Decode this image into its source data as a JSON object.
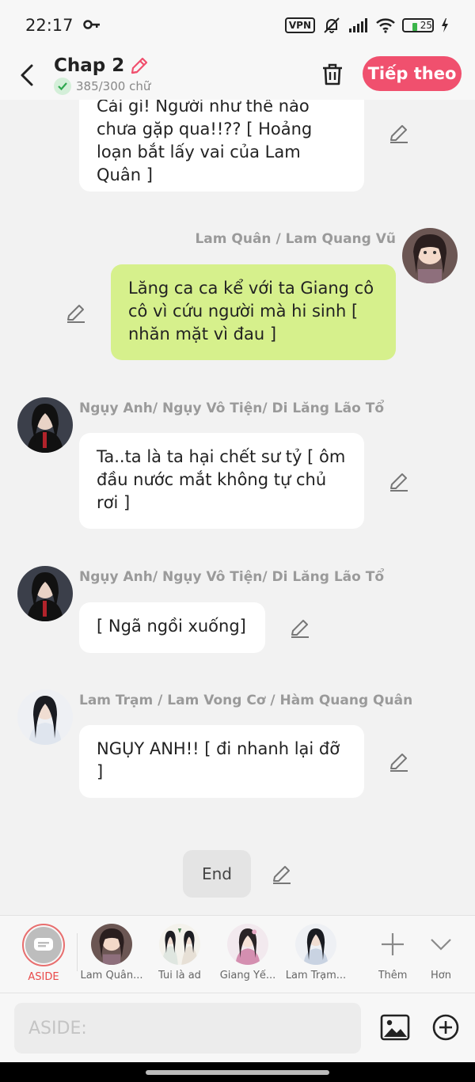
{
  "status_bar": {
    "time": "22:17",
    "vpn_label": "VPN",
    "battery": "25"
  },
  "header": {
    "title": "Chap 2",
    "word_count": "385/300 chữ",
    "next_label": "Tiếp theo"
  },
  "messages": [
    {
      "speaker": "",
      "text": "Cái gì! Người như thế nào chưa gặp qua!!?? [ Hoảng loạn bắt lấy vai của Lam Quân ]",
      "side": "left",
      "avatar_icon": "none"
    },
    {
      "speaker": "Lam Quân / Lam Quang Vũ",
      "text": "Lăng ca ca kể với ta Giang cô cô vì cứu người mà hi sinh [ nhăn mặt vì đau ]",
      "side": "right",
      "avatar_icon": "dark-hair-girl"
    },
    {
      "speaker": "Ngụy Anh/ Ngụy Vô Tiện/ Di Lăng Lão Tổ",
      "text": "Ta..ta là ta hại chết sư tỷ [ ôm đầu nước mắt không tự chủ rơi ]",
      "side": "left",
      "avatar_icon": "black-robe-man"
    },
    {
      "speaker": "Ngụy Anh/ Ngụy Vô Tiện/ Di Lăng Lão Tổ",
      "text": "[ Ngã ngồi xuống]",
      "side": "left",
      "avatar_icon": "black-robe-man"
    },
    {
      "speaker": "Lam Trạm / Lam Vong Cơ / Hàm Quang Quân",
      "text": "NGỤY ANH!! [ đi nhanh lại đỡ ]",
      "side": "left",
      "avatar_icon": "white-robe-man"
    }
  ],
  "end_label": "End",
  "characters": [
    {
      "name": "ASIDE",
      "icon": "aside-icon"
    },
    {
      "name": "Lam Quân...",
      "icon": "dark-hair-girl"
    },
    {
      "name": "Tui là ad",
      "icon": "group-icon"
    },
    {
      "name": "Giang Yế...",
      "icon": "pink-girl"
    },
    {
      "name": "Lam Trạm...",
      "icon": "white-robe-man"
    }
  ],
  "bar_actions": {
    "add_label": "Thêm",
    "more_label": "Hơn"
  },
  "input": {
    "placeholder": "ASIDE:"
  },
  "colors": {
    "accent": "#f0506e",
    "green_bubble": "#d6f08c",
    "aside_red": "#e94a4a"
  }
}
